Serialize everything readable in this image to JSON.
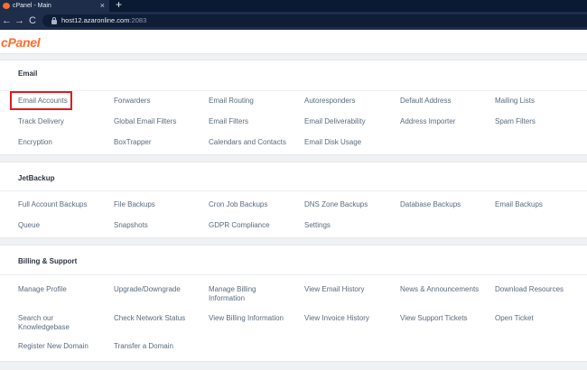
{
  "browser": {
    "tab_title": "cPanel - Main",
    "tab_close": "×",
    "new_tab": "+",
    "back": "←",
    "forward": "→",
    "reload": "C",
    "url_host": "host12.azaronline.com",
    "url_port": ":2083"
  },
  "header": {
    "logo": "cPanel"
  },
  "sections": {
    "email": {
      "title": "Email",
      "links": [
        "Email Accounts",
        "Forwarders",
        "Email Routing",
        "Autoresponders",
        "Default Address",
        "Mailing Lists",
        "Track Delivery",
        "Global Email Filters",
        "Email Filters",
        "Email Deliverability",
        "Address Importer",
        "Spam Filters",
        "Encryption",
        "BoxTrapper",
        "Calendars and Contacts",
        "Email Disk Usage"
      ]
    },
    "jetbackup": {
      "title": "JetBackup",
      "links": [
        "Full Account Backups",
        "File Backups",
        "Cron Job Backups",
        "DNS Zone Backups",
        "Database Backups",
        "Email Backups",
        "Queue",
        "Snapshots",
        "GDPR Compliance",
        "Settings"
      ]
    },
    "billing": {
      "title": "Billing & Support",
      "links": [
        "Manage Profile",
        "Upgrade/Downgrade",
        "Manage Billing Information",
        "View Email History",
        "News & Announcements",
        "Download Resources",
        "Search our Knowledgebase",
        "Check Network Status",
        "View Billing Information",
        "View Invoice History",
        "View Support Tickets",
        "Open Ticket",
        "Register New Domain",
        "Transfer a Domain"
      ]
    }
  }
}
